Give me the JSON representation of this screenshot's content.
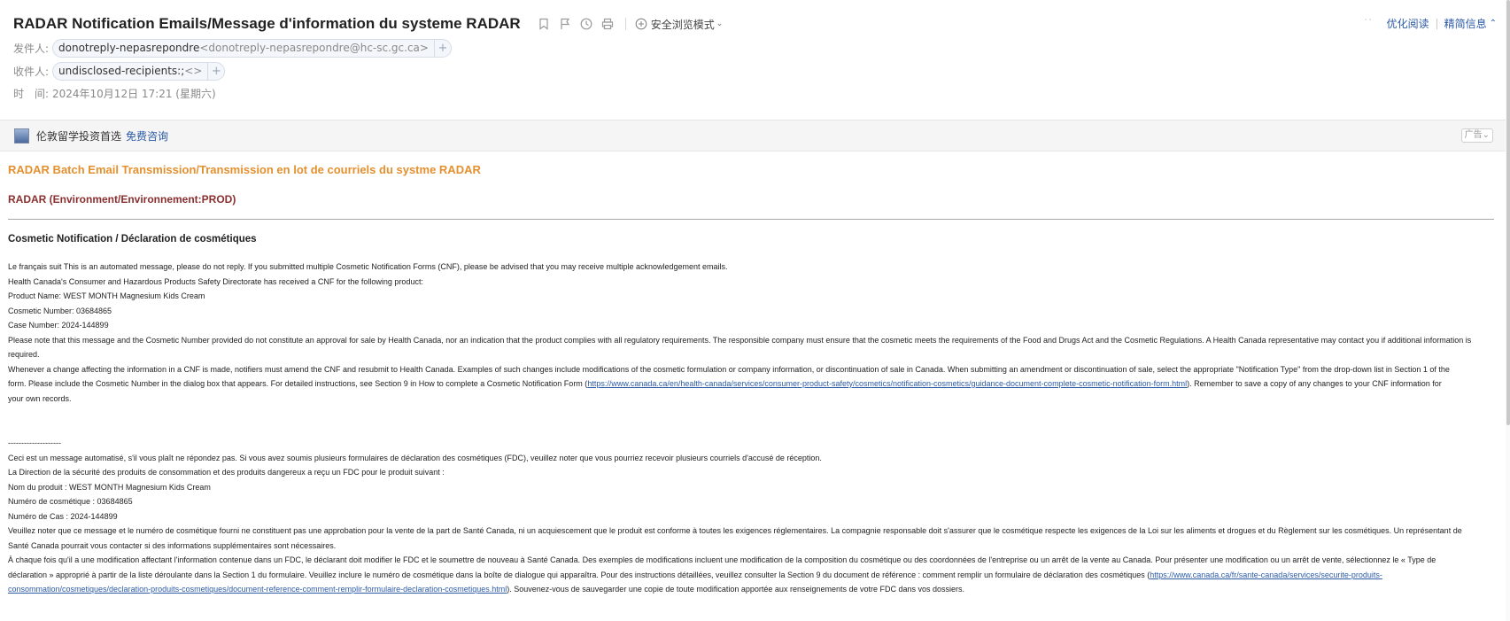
{
  "header": {
    "subject": "RADAR Notification Emails/Message d'information du systeme RADAR",
    "icons": [
      "bookmark-icon",
      "flag-icon",
      "clock-icon",
      "print-icon"
    ],
    "safe_mode_label": "安全浏览模式",
    "read_optimize": "优化阅读",
    "brief_info": "精简信息"
  },
  "meta": {
    "from_label": "发件人:",
    "from_name": "donotreply-nepasrepondre",
    "from_addr": "<donotreply-nepasrepondre@hc-sc.gc.ca>",
    "to_label": "收件人:",
    "to_name": "undisclosed-recipients:;",
    "to_addr": "<>",
    "time_label": "时　间:",
    "time_value": "2024年10月12日 17:21 (星期六)"
  },
  "ad": {
    "text": "伦敦留学投资首选",
    "link": "免费咨询",
    "tag": "广告"
  },
  "body": {
    "batch_title": "RADAR Batch Email Transmission/Transmission en lot de courriels du systme RADAR",
    "environment": "RADAR (Environment/Environnement:PROD)",
    "section_title": "Cosmetic Notification / Déclaration de cosmétiques",
    "en": {
      "l1": "Le français suit This is an automated message, please do not reply. If you submitted multiple Cosmetic Notification Forms (CNF), please be advised that you may receive multiple acknowledgement emails.",
      "l2": "Health Canada's Consumer and Hazardous Products Safety Directorate has received a CNF for the following product:",
      "l3": "Product Name: WEST MONTH Magnesium Kids Cream",
      "l4": "Cosmetic Number: 03684865",
      "l5": "Case Number: 2024-144899",
      "l6": "Please note that this message and the Cosmetic Number provided do not constitute an approval for sale by Health Canada, nor an indication that the product complies with all regulatory requirements. The responsible company must ensure that the cosmetic meets the requirements of the Food and Drugs Act and the Cosmetic Regulations. A Health Canada representative may contact you if additional information is",
      "l7": "required.",
      "l8": "Whenever a change affecting the information in a CNF is made, notifiers must amend the CNF and resubmit to Health Canada. Examples of such changes include modifications of the cosmetic formulation or company information, or discontinuation of sale in Canada. When submitting an amendment or discontinuation of sale, select the appropriate \"Notification Type\" from the drop-down list in Section 1 of the",
      "l9a": "form. Please include the Cosmetic Number in the dialog box that appears. For detailed instructions, see Section 9 in How to complete a Cosmetic Notification Form (",
      "l9link": "https://www.canada.ca/en/health-canada/services/consumer-product-safety/cosmetics/notification-cosmetics/guidance-document-complete-cosmetic-notification-form.html",
      "l9b": "). Remember to save a copy of any changes to your CNF information for",
      "l10": "your own records."
    },
    "divider": "--------------------",
    "fr": {
      "l1": "Ceci est un message automatisé, s'il vous plaît ne répondez pas. Si vous avez soumis plusieurs formulaires de déclaration des cosmétiques (FDC), veuillez noter que vous pourriez recevoir plusieurs courriels d'accusé de réception.",
      "l2": "La Direction de la sécurité des produits de consommation et des produits dangereux a reçu un FDC pour le produit suivant :",
      "l3": "Nom du produit : WEST MONTH Magnesium Kids Cream",
      "l4": "Numéro de cosmétique : 03684865",
      "l5": "Numéro de Cas : 2024-144899",
      "l6": "Veuillez noter que ce message et le numéro de cosmétique fourni ne constituent pas une approbation pour la vente de la part de Santé Canada, ni un acquiescement que le produit est conforme à toutes les exigences réglementaires. La compagnie responsable doit s'assurer que le cosmétique respecte les exigences de la Loi sur les aliments et drogues et du Règlement sur les cosmétiques. Un représentant de",
      "l7": "Santé Canada pourrait vous contacter si des informations supplémentaires sont nécessaires.",
      "l8": "À chaque fois qu'il a une modification affectant l'information contenue dans un FDC, le déclarant doit modifier le FDC et le soumettre de nouveau à Santé Canada. Des exemples de modifications incluent une modification de la composition du cosmétique ou des coordonnées de l'entreprise ou un arrêt de la vente au Canada. Pour présenter une modification ou un arrêt de vente, sélectionnez le « Type de",
      "l9a": "déclaration » approprié à partir de la liste déroulante dans la Section 1 du formulaire. Veuillez inclure le numéro de cosmétique dans la boîte de dialogue qui apparaîtra. Pour des instructions détaillées, veuillez consulter la Section 9 du document de référence : comment remplir un formulaire de déclaration des cosmétiques (",
      "l9link": "https://www.canada.ca/fr/sante-canada/services/securite-produits-",
      "l10link": "consommation/cosmetiques/declaration-produits-cosmetiques/document-reference-comment-remplir-formulaire-declaration-cosmetiques.html",
      "l10b": "). Souvenez-vous de sauvegarder une copie de toute modification apportée aux renseignements de votre FDC dans vos dossiers."
    }
  },
  "colors": {
    "batch_title": "#e4902f",
    "environment": "#8a2f2f",
    "link": "#2b5aa7"
  }
}
